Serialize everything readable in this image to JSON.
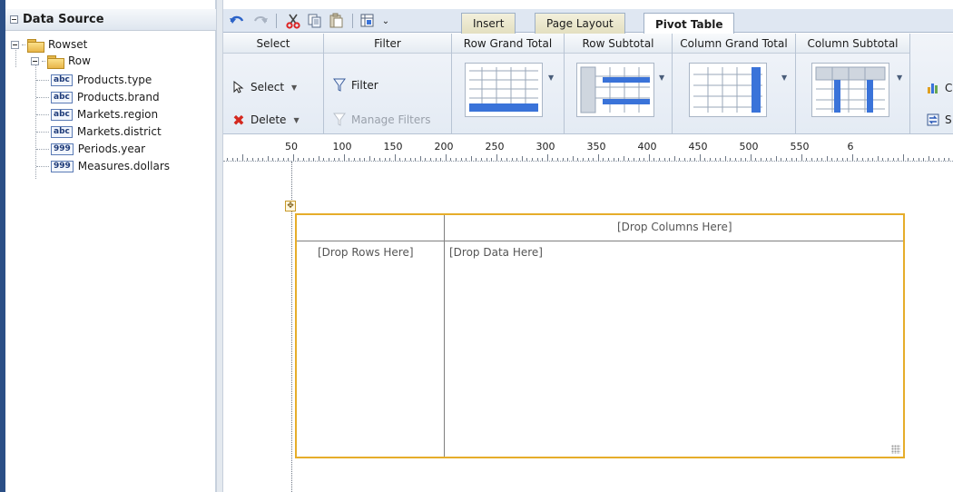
{
  "data_source": {
    "title": "Data Source",
    "tree": {
      "root": "Rowset",
      "child": "Row",
      "fields": [
        {
          "badge": "abc",
          "label": "Products.type"
        },
        {
          "badge": "abc",
          "label": "Products.brand"
        },
        {
          "badge": "abc",
          "label": "Markets.region"
        },
        {
          "badge": "abc",
          "label": "Markets.district"
        },
        {
          "badge": "999",
          "label": "Periods.year"
        },
        {
          "badge": "999",
          "label": "Measures.dollars"
        }
      ]
    }
  },
  "tabs": [
    {
      "label": "Insert",
      "active": false
    },
    {
      "label": "Page Layout",
      "active": false
    },
    {
      "label": "Pivot Table",
      "active": true
    }
  ],
  "ribbon": {
    "select_group": {
      "title": "Select",
      "select_label": "Select",
      "delete_label": "Delete"
    },
    "filter_group": {
      "title": "Filter",
      "filter_label": "Filter",
      "manage_label": "Manage Filters"
    },
    "row_grand_total": {
      "title": "Row Grand Total"
    },
    "row_subtotal": {
      "title": "Row Subtotal"
    },
    "column_grand_total": {
      "title": "Column Grand Total"
    },
    "column_subtotal": {
      "title": "Column Subtotal"
    },
    "cut_label_1": "C",
    "cut_label_2": "S"
  },
  "ruler": {
    "labels": [
      "50",
      "100",
      "150",
      "200",
      "250",
      "300",
      "350",
      "400",
      "450",
      "500",
      "550",
      "6"
    ]
  },
  "pivot": {
    "columns_placeholder": "[Drop Columns Here]",
    "rows_placeholder": "[Drop Rows Here]",
    "data_placeholder": "[Drop Data Here]"
  },
  "colors": {
    "accent_blue": "#3a73d9",
    "selection_border": "#e6ad2a",
    "panel_edge": "#2b4f86"
  }
}
